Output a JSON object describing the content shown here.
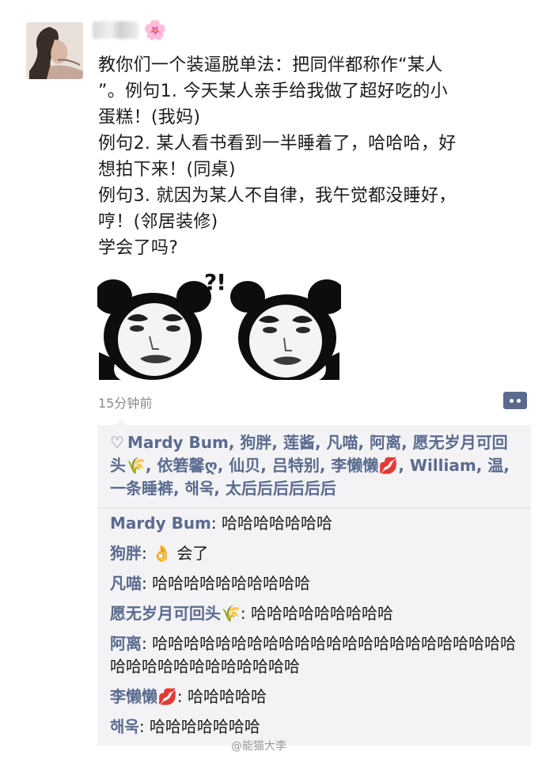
{
  "post": {
    "name_emoji": "🌸",
    "text": "教你们一个装逼脱单法：把同伴都称作“某人\n”。例句1. 今天某人亲手给我做了超好吃的小\n蛋糕！(我妈)\n例句2. 某人看书看到一半睡着了，哈哈哈，好\n想拍下来！(同桌)\n例句3. 就因为某人不自律，我午觉都没睡好，\n哼！(邻居装修)\n学会了吗?",
    "meme_text": "?!",
    "time": "15分钟前"
  },
  "likes": {
    "heart_icon": "♡",
    "text": "Mardy Bum, 狗胖, 莲酱, 凡喵, 阿离, 愿无岁月可回头🌾, 依箬馨ღ, 仙贝, 吕特别, 李懒懒💋, William, 温, 一条睡裤, 해욱, 太后后后后后后"
  },
  "comments": [
    {
      "name": "Mardy Bum",
      "text": ": 哈哈哈哈哈哈哈"
    },
    {
      "name": "狗胖",
      "text": ": 👌 会了"
    },
    {
      "name": "凡喵",
      "text": ": 哈哈哈哈哈哈哈哈哈哈"
    },
    {
      "name": "愿无岁月可回头🌾",
      "text": ": 哈哈哈哈哈哈哈哈哈"
    },
    {
      "name": "阿离",
      "text": ": 哈哈哈哈哈哈哈哈哈哈哈哈哈哈哈哈哈哈哈哈哈哈哈哈哈哈哈哈哈哈哈哈哈哈哈"
    },
    {
      "name": "李懒懒💋",
      "text": ": 哈哈哈哈哈"
    },
    {
      "name": "해욱",
      "text": ": 哈哈哈哈哈哈哈"
    }
  ],
  "watermark": "@能猫大李",
  "colors": {
    "name_link": "#5b6b8f",
    "panel_bg": "#f3f3f5",
    "time_gray": "#8a8a8a"
  }
}
